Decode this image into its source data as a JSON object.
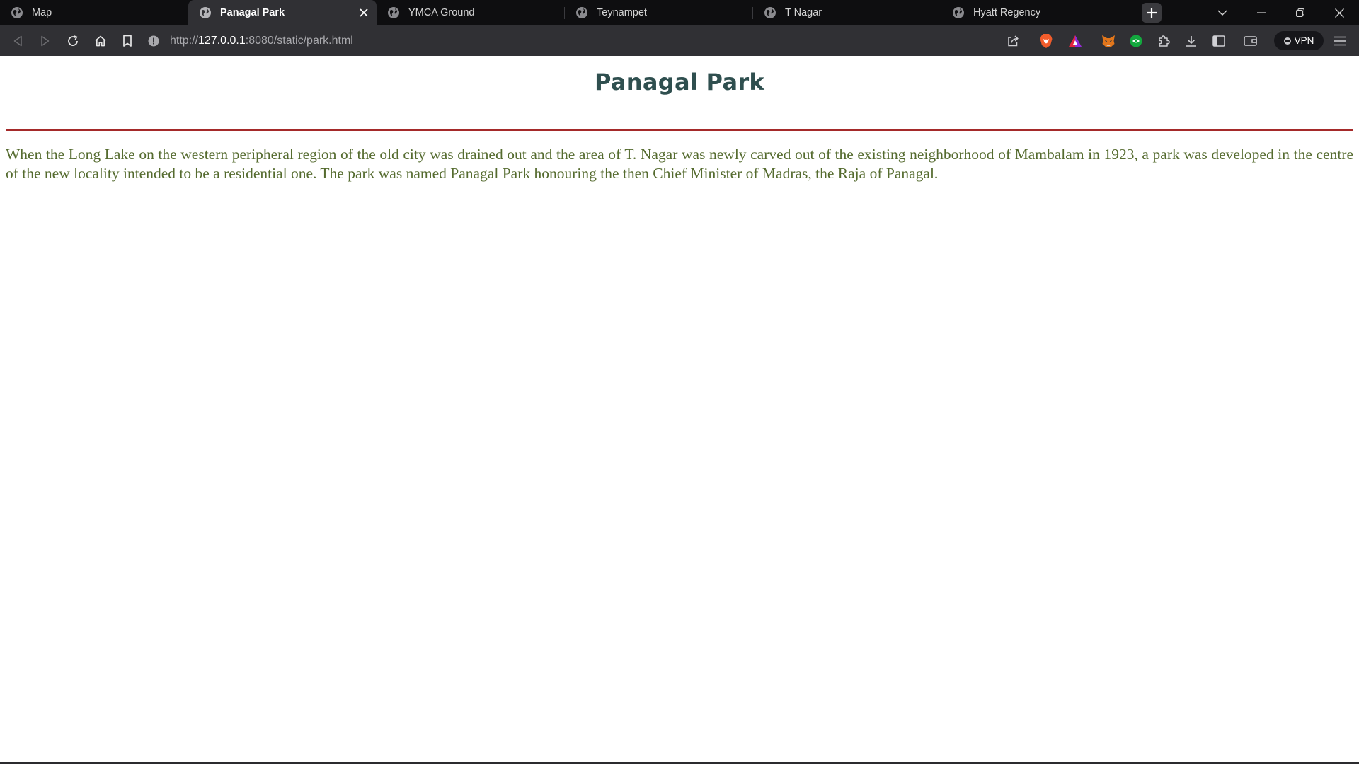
{
  "browser": {
    "tabs": [
      {
        "title": "Map",
        "active": false
      },
      {
        "title": "Panagal Park",
        "active": true
      },
      {
        "title": "YMCA Ground",
        "active": false
      },
      {
        "title": "Teynampet",
        "active": false
      },
      {
        "title": "T Nagar",
        "active": false
      },
      {
        "title": "Hyatt Regency",
        "active": false
      }
    ],
    "url": {
      "scheme": "http://",
      "host": "127.0.0.1",
      "rest": ":8080/static/park.html"
    },
    "vpn_label": "VPN",
    "icons": {
      "tab": "globe-icon",
      "new_tab": "plus-icon",
      "toolbar_left": [
        "back-icon",
        "forward-icon",
        "reload-icon",
        "home-icon",
        "bookmark-icon"
      ],
      "toolbar_right": [
        "share-icon",
        "brave-shield-icon",
        "brave-rewards-icon",
        "metamask-fox-icon",
        "extension-green-icon",
        "puzzle-extensions-icon",
        "download-icon",
        "sidebar-icon",
        "wallet-icon",
        "menu-icon"
      ]
    },
    "colors": {
      "tabstrip_bg": "#0e0e10",
      "toolbar_bg": "#303034",
      "active_tab_bg": "#303034",
      "brave_orange": "#f25c2b",
      "rewards_purple": "#8b2bd8",
      "rewards_red": "#e3243e",
      "extension_green": "#13a83e"
    }
  },
  "page": {
    "title": "Panagal Park",
    "paragraph": "When the Long Lake on the western peripheral region of the old city was drained out and the area of T. Nagar was newly carved out of the existing neighborhood of Mambalam in 1923, a park was developed in the centre of the new locality intended to be a residential one. The park was named Panagal Park honouring the then Chief Minister of Madras, the Raja of Panagal.",
    "colors": {
      "title": "#2f4f4f",
      "rule": "#a52a2a",
      "text": "#556b2f"
    }
  }
}
